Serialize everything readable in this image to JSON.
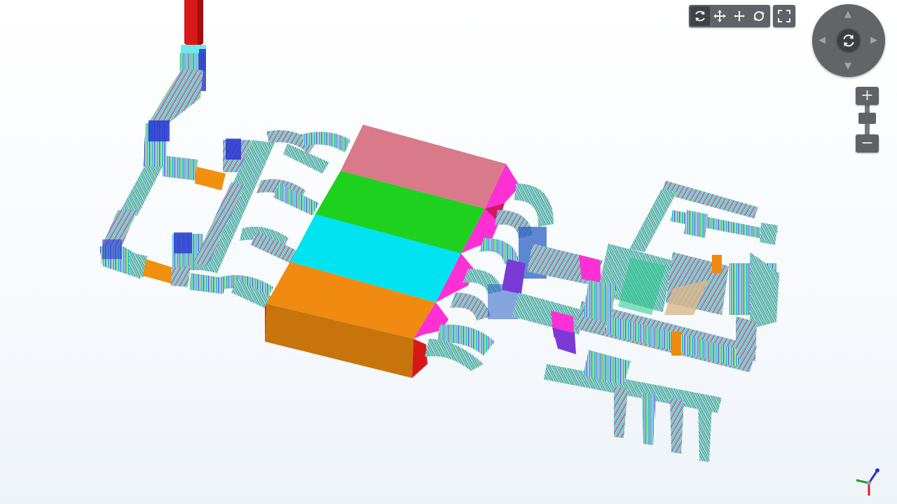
{
  "toolbar": {
    "tools": [
      {
        "icon": "orbit-icon",
        "active": true
      },
      {
        "icon": "pan-icon",
        "active": false
      },
      {
        "icon": "pan-zoom-icon",
        "active": false
      },
      {
        "icon": "orbit-alt-icon",
        "active": false
      }
    ],
    "fullscreen_icon": "fullscreen-icon"
  },
  "nav_wheel": {
    "arrows": {
      "up": "▲",
      "down": "▼",
      "left": "◀",
      "right": "▶"
    },
    "center_icon": "rotate-icon"
  },
  "zoom": {
    "in_label": "+",
    "out_label": "−",
    "level": 0.5
  },
  "colors": {
    "pink_block": "#d87a8a",
    "green_block": "#1fd11f",
    "cyan_block": "#00e4f2",
    "orange_block": "#f08a10",
    "magenta_transition": "#ff2fd6",
    "stack_red": "#d81818",
    "toolbar_bg": "#5f6266"
  }
}
